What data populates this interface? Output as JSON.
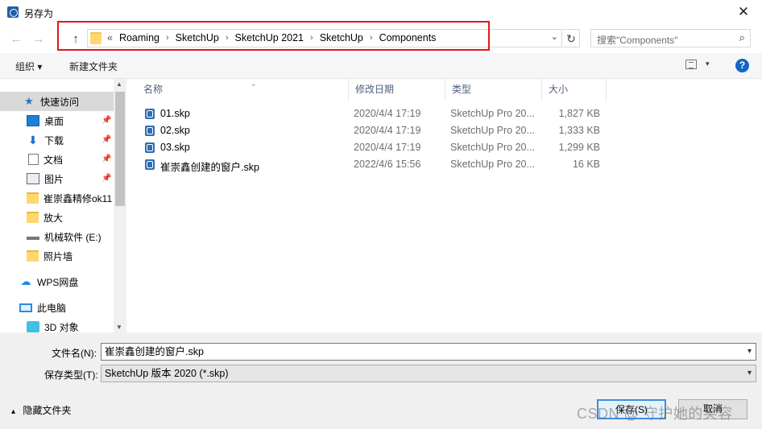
{
  "window": {
    "title": "另存为",
    "close_glyph": "✕"
  },
  "nav": {
    "back": "←",
    "forward": "→",
    "up": "↑"
  },
  "address": {
    "overflow": "«",
    "crumbs": [
      "Roaming",
      "SketchUp",
      "SketchUp 2021",
      "SketchUp",
      "Components"
    ],
    "sep": "›",
    "dropdown": "⌄",
    "refresh": "↻"
  },
  "search": {
    "placeholder": "搜索\"Components\"",
    "icon": "⌕"
  },
  "toolbar": {
    "organize": "组织 ▾",
    "new_folder": "新建文件夹",
    "view_dd": "▾",
    "help": "?"
  },
  "sidebar": {
    "items": [
      {
        "label": "快速访问",
        "icon": "star-icon",
        "selected": true,
        "pinned": false
      },
      {
        "label": "桌面",
        "icon": "desktop-icon",
        "pinned": true
      },
      {
        "label": "下载",
        "icon": "download-icon",
        "pinned": true
      },
      {
        "label": "文档",
        "icon": "document-icon",
        "pinned": true
      },
      {
        "label": "图片",
        "icon": "picture-icon",
        "pinned": true
      },
      {
        "label": "崔崇鑫精修ok11",
        "icon": "folder-icon",
        "pinned": false
      },
      {
        "label": "放大",
        "icon": "folder-icon",
        "pinned": false
      },
      {
        "label": "机械软件 (E:)",
        "icon": "drive-icon",
        "pinned": false
      },
      {
        "label": "照片墙",
        "icon": "folder-icon",
        "pinned": false
      },
      {
        "label": "WPS网盘",
        "icon": "cloud-icon",
        "pinned": false
      },
      {
        "label": "此电脑",
        "icon": "computer-icon",
        "pinned": false
      },
      {
        "label": "3D 对象",
        "icon": "3d-objects-icon",
        "pinned": false
      }
    ],
    "pin_glyph": "📌"
  },
  "columns": {
    "name": "名称",
    "date": "修改日期",
    "type": "类型",
    "size": "大小",
    "sort_glyph": "⌃"
  },
  "files": [
    {
      "name": "01.skp",
      "date": "2020/4/4 17:19",
      "type": "SketchUp Pro 20...",
      "size": "1,827 KB"
    },
    {
      "name": "02.skp",
      "date": "2020/4/4 17:19",
      "type": "SketchUp Pro 20...",
      "size": "1,333 KB"
    },
    {
      "name": "03.skp",
      "date": "2020/4/4 17:19",
      "type": "SketchUp Pro 20...",
      "size": "1,299 KB"
    },
    {
      "name": "崔崇鑫创建的窗户.skp",
      "date": "2022/4/6 15:56",
      "type": "SketchUp Pro 20...",
      "size": "16 KB"
    }
  ],
  "form": {
    "filename_label": "文件名(N):",
    "filename_value": "崔崇鑫创建的窗户.skp",
    "filetype_label": "保存类型(T):",
    "filetype_value": "SketchUp 版本 2020 (*.skp)",
    "dd": "▾"
  },
  "footer": {
    "hide_folders": "隐藏文件夹",
    "hide_glyph": "▴",
    "save": "保存(S)",
    "cancel": "取消"
  },
  "watermark": "CSDN @ 守护她的笑容",
  "colors": {
    "highlight": "#e0181a",
    "accent": "#1464c8"
  }
}
